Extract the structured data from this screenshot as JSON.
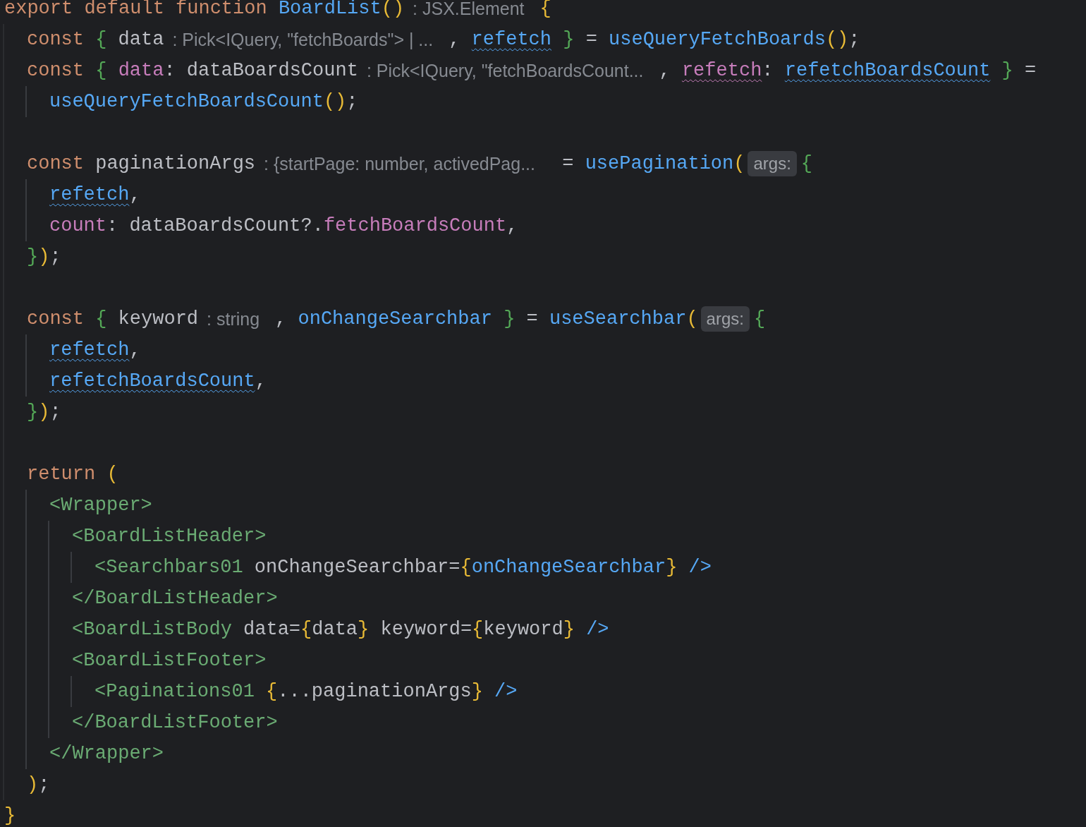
{
  "editor": {
    "lines": [
      {
        "kind": "code",
        "tokens": [
          {
            "kind": "keyword",
            "text": "export default function "
          },
          {
            "kind": "function",
            "text": "BoardList"
          },
          {
            "kind": "bracket",
            "text": "()"
          },
          {
            "kind": "hint",
            "text": ": JSX.Element"
          },
          {
            "kind": "bracket",
            "text": "{"
          }
        ],
        "children": [
          {
            "kind": "code",
            "tokens": [
              {
                "kind": "keyword",
                "text": "const "
              },
              {
                "kind": "brace",
                "text": "{"
              },
              {
                "kind": "plain",
                "text": " data"
              },
              {
                "kind": "hint",
                "text": ": Pick<IQuery, \"fetchBoards\"> | ..."
              },
              {
                "kind": "plain",
                "text": ", "
              },
              {
                "kind": "flagged",
                "text": "refetch"
              },
              {
                "kind": "brace",
                "text": " }"
              },
              {
                "kind": "plain",
                "text": " = "
              },
              {
                "kind": "function",
                "text": "useQueryFetchBoards"
              },
              {
                "kind": "bracket",
                "text": "()"
              },
              {
                "kind": "plain",
                "text": ";"
              }
            ]
          },
          {
            "kind": "code",
            "tokens": [
              {
                "kind": "keyword",
                "text": "const "
              },
              {
                "kind": "brace",
                "text": "{ "
              },
              {
                "kind": "property",
                "text": "data"
              },
              {
                "kind": "plain",
                "text": ": dataBoardsCount"
              },
              {
                "kind": "hint",
                "text": ": Pick<IQuery, \"fetchBoardsCount..."
              },
              {
                "kind": "plain",
                "text": ", "
              },
              {
                "kind": "flaggedprop",
                "text": "refetch"
              },
              {
                "kind": "plain",
                "text": ": "
              },
              {
                "kind": "flagged",
                "text": "refetchBoardsCount"
              },
              {
                "kind": "brace",
                "text": " }"
              },
              {
                "kind": "plain",
                "text": " ="
              }
            ],
            "children": [
              {
                "kind": "code",
                "tokens": [
                  {
                    "kind": "function",
                    "text": "useQueryFetchBoardsCount"
                  },
                  {
                    "kind": "bracket",
                    "text": "()"
                  },
                  {
                    "kind": "plain",
                    "text": ";"
                  }
                ]
              }
            ]
          },
          {
            "kind": "blank"
          },
          {
            "kind": "code",
            "tokens": [
              {
                "kind": "keyword",
                "text": "const "
              },
              {
                "kind": "plain",
                "text": "paginationArgs"
              },
              {
                "kind": "hint",
                "text": ": {startPage: number, activedPag..."
              },
              {
                "kind": "plain",
                "text": " = "
              },
              {
                "kind": "function",
                "text": "usePagination"
              },
              {
                "kind": "bracket",
                "text": "("
              },
              {
                "kind": "chip",
                "text": "args:"
              },
              {
                "kind": "brace",
                "text": "{"
              }
            ],
            "children": [
              {
                "kind": "code",
                "tokens": [
                  {
                    "kind": "flagged",
                    "text": "refetch"
                  },
                  {
                    "kind": "plain",
                    "text": ","
                  }
                ]
              },
              {
                "kind": "code",
                "tokens": [
                  {
                    "kind": "property",
                    "text": "count"
                  },
                  {
                    "kind": "plain",
                    "text": ": dataBoardsCount?."
                  },
                  {
                    "kind": "property",
                    "text": "fetchBoardsCount"
                  },
                  {
                    "kind": "plain",
                    "text": ","
                  }
                ]
              }
            ]
          },
          {
            "kind": "code",
            "tokens": [
              {
                "kind": "brace",
                "text": "}"
              },
              {
                "kind": "bracket",
                "text": ")"
              },
              {
                "kind": "plain",
                "text": ";"
              }
            ]
          },
          {
            "kind": "blank"
          },
          {
            "kind": "code",
            "tokens": [
              {
                "kind": "keyword",
                "text": "const "
              },
              {
                "kind": "brace",
                "text": "{"
              },
              {
                "kind": "plain",
                "text": " keyword"
              },
              {
                "kind": "hint",
                "text": ": string"
              },
              {
                "kind": "plain",
                "text": ", "
              },
              {
                "kind": "function",
                "text": "onChangeSearchbar"
              },
              {
                "kind": "brace",
                "text": " }"
              },
              {
                "kind": "plain",
                "text": " = "
              },
              {
                "kind": "function",
                "text": "useSearchbar"
              },
              {
                "kind": "bracket",
                "text": "("
              },
              {
                "kind": "chip",
                "text": "args:"
              },
              {
                "kind": "brace",
                "text": "{"
              }
            ],
            "children": [
              {
                "kind": "code",
                "tokens": [
                  {
                    "kind": "flagged",
                    "text": "refetch"
                  },
                  {
                    "kind": "plain",
                    "text": ","
                  }
                ]
              },
              {
                "kind": "code",
                "tokens": [
                  {
                    "kind": "flagged",
                    "text": "refetchBoardsCount"
                  },
                  {
                    "kind": "plain",
                    "text": ","
                  }
                ]
              }
            ]
          },
          {
            "kind": "code",
            "tokens": [
              {
                "kind": "brace",
                "text": "}"
              },
              {
                "kind": "bracket",
                "text": ")"
              },
              {
                "kind": "plain",
                "text": ";"
              }
            ]
          },
          {
            "kind": "blank"
          },
          {
            "kind": "code",
            "tokens": [
              {
                "kind": "keyword",
                "text": "return "
              },
              {
                "kind": "bracket",
                "text": "("
              }
            ],
            "children": [
              {
                "kind": "code",
                "tokens": [
                  {
                    "kind": "tag",
                    "text": "<Wrapper>"
                  }
                ],
                "children": [
                  {
                    "kind": "code",
                    "tokens": [
                      {
                        "kind": "tag",
                        "text": "<BoardListHeader>"
                      }
                    ],
                    "children": [
                      {
                        "kind": "code",
                        "tokens": [
                          {
                            "kind": "tag",
                            "text": "<Searchbars01"
                          },
                          {
                            "kind": "plain",
                            "text": " onChangeSearchbar="
                          },
                          {
                            "kind": "bracket",
                            "text": "{"
                          },
                          {
                            "kind": "function",
                            "text": "onChangeSearchbar"
                          },
                          {
                            "kind": "bracket",
                            "text": "}"
                          },
                          {
                            "kind": "jsxend",
                            "text": " />"
                          }
                        ]
                      }
                    ]
                  },
                  {
                    "kind": "code",
                    "tokens": [
                      {
                        "kind": "tag",
                        "text": "</BoardListHeader>"
                      }
                    ]
                  },
                  {
                    "kind": "code",
                    "tokens": [
                      {
                        "kind": "tag",
                        "text": "<BoardListBody"
                      },
                      {
                        "kind": "plain",
                        "text": " data="
                      },
                      {
                        "kind": "bracket",
                        "text": "{"
                      },
                      {
                        "kind": "plain",
                        "text": "data"
                      },
                      {
                        "kind": "bracket",
                        "text": "}"
                      },
                      {
                        "kind": "plain",
                        "text": " keyword="
                      },
                      {
                        "kind": "bracket",
                        "text": "{"
                      },
                      {
                        "kind": "plain",
                        "text": "keyword"
                      },
                      {
                        "kind": "bracket",
                        "text": "}"
                      },
                      {
                        "kind": "jsxend",
                        "text": " />"
                      }
                    ]
                  },
                  {
                    "kind": "code",
                    "tokens": [
                      {
                        "kind": "tag",
                        "text": "<BoardListFooter>"
                      }
                    ],
                    "children": [
                      {
                        "kind": "code",
                        "tokens": [
                          {
                            "kind": "tag",
                            "text": "<Paginations01"
                          },
                          {
                            "kind": "bracket",
                            "text": " {"
                          },
                          {
                            "kind": "plain",
                            "text": "...paginationArgs"
                          },
                          {
                            "kind": "bracket",
                            "text": "}"
                          },
                          {
                            "kind": "jsxend",
                            "text": " />"
                          }
                        ]
                      }
                    ]
                  },
                  {
                    "kind": "code",
                    "tokens": [
                      {
                        "kind": "tag",
                        "text": "</BoardListFooter>"
                      }
                    ]
                  }
                ]
              },
              {
                "kind": "code",
                "tokens": [
                  {
                    "kind": "tag",
                    "text": "</Wrapper>"
                  }
                ]
              }
            ]
          },
          {
            "kind": "code",
            "tokens": [
              {
                "kind": "bracket",
                "text": ")"
              },
              {
                "kind": "plain",
                "text": ";"
              }
            ]
          }
        ]
      },
      {
        "kind": "code",
        "tokens": [
          {
            "kind": "bracket",
            "text": "}"
          }
        ]
      }
    ]
  }
}
